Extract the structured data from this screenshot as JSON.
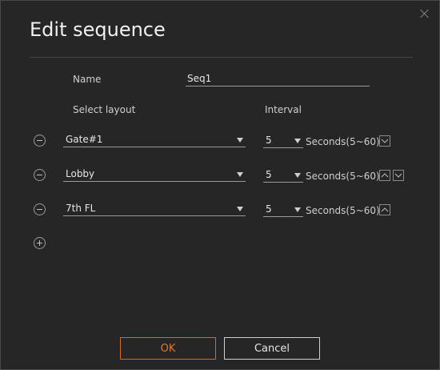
{
  "dialog": {
    "title": "Edit sequence",
    "name_label": "Name",
    "name_value": "Seq1",
    "select_layout_label": "Select layout",
    "interval_label": "Interval",
    "rows": [
      {
        "layout": "Gate#1",
        "interval": "5",
        "unit": "Seconds(5~60)"
      },
      {
        "layout": "Lobby",
        "interval": "5",
        "unit": "Seconds(5~60)"
      },
      {
        "layout": "7th FL",
        "interval": "5",
        "unit": "Seconds(5~60)"
      }
    ],
    "ok_label": "OK",
    "cancel_label": "Cancel"
  },
  "colors": {
    "background": "#262626",
    "accent": "#e07a2a",
    "text": "#d6d6d6"
  }
}
